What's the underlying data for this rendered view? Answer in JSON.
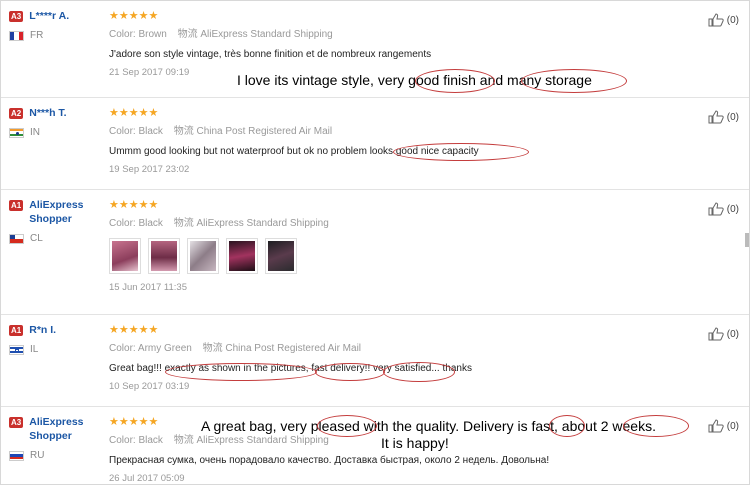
{
  "reviews": [
    {
      "level": "A3",
      "name": "L****r A.",
      "country": "FR",
      "stars": "★★★★★",
      "color_label": "Color:",
      "color": "Brown",
      "ship_cn": "物流",
      "shipping": "AliExpress Standard Shipping",
      "text": "J'adore son style vintage, très bonne finition et de nombreux rangements",
      "date": "21 Sep 2017 09:19",
      "helpful": "(0)",
      "annotation": "I love its vintage style, very good finish and many storage"
    },
    {
      "level": "A2",
      "name": "N***h T.",
      "country": "IN",
      "stars": "★★★★★",
      "color_label": "Color:",
      "color": "Black",
      "ship_cn": "物流",
      "shipping": "China Post Registered Air Mail",
      "text": "Ummm good looking but not waterproof but ok no problem looks good nice capacity",
      "date": "19 Sep 2017 23:02",
      "helpful": "(0)"
    },
    {
      "level": "A1",
      "name": "AliExpress Shopper",
      "country": "CL",
      "stars": "★★★★★",
      "color_label": "Color:",
      "color": "Black",
      "ship_cn": "物流",
      "shipping": "AliExpress Standard Shipping",
      "date": "15 Jun 2017 11:35",
      "helpful": "(0)"
    },
    {
      "level": "A1",
      "name": "R*n I.",
      "country": "IL",
      "stars": "★★★★★",
      "color_label": "Color:",
      "color": "Army Green",
      "ship_cn": "物流",
      "shipping": "China Post Registered Air Mail",
      "text": "Great bag!!! exactly as shown in the pictures, fast delivery!! very satisfied... thanks",
      "date": "10 Sep 2017 03:19",
      "helpful": "(0)"
    },
    {
      "level": "A3",
      "name": "AliExpress Shopper",
      "country": "RU",
      "stars": "★★★★★",
      "color_label": "Color:",
      "color": "Black",
      "ship_cn": "物流",
      "shipping": "AliExpress Standard Shipping",
      "text": "Прекрасная сумка, очень порадовало качество. Доставка быстрая, около 2 недель. Довольна!",
      "date": "26 Jul 2017 05:09",
      "helpful": "(0)",
      "annotation_line1": "A great bag, very pleased with the quality. Delivery is fast, about 2 weeks.",
      "annotation_line2": "It is happy!"
    }
  ],
  "colors": {
    "username": "#1c57a5",
    "level_badge": "#c9302c",
    "stars": "#f5a623",
    "oval": "#c43d3d"
  },
  "icons": {
    "helpful": "thumbs-up-icon"
  }
}
